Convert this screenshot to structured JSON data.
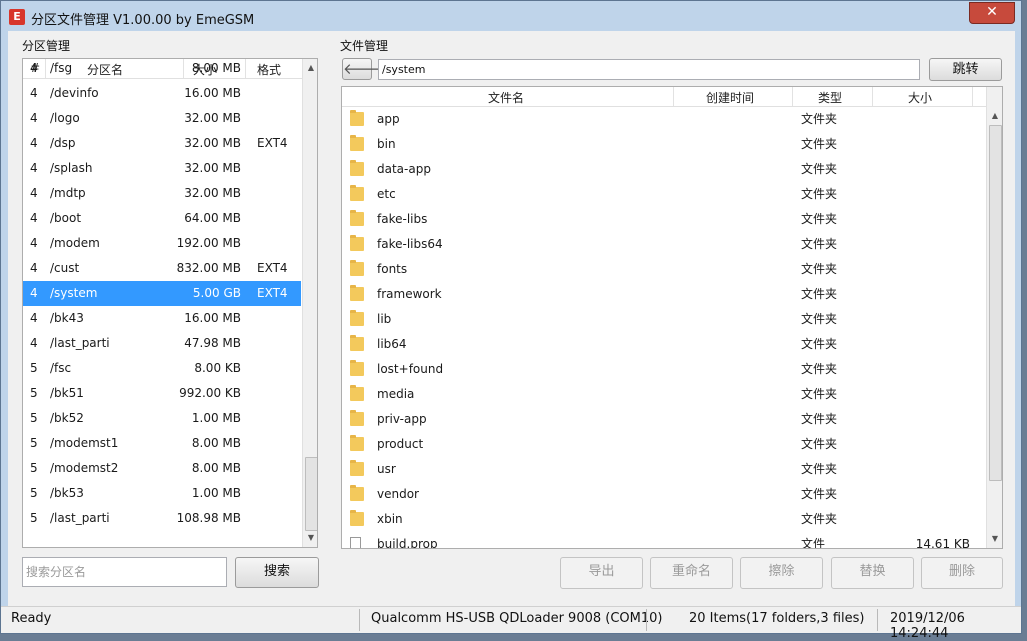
{
  "window": {
    "title": "分区文件管理 V1.00.00 by EmeGSM",
    "icon_glyph": "E",
    "close_glyph": "✕"
  },
  "partition_panel": {
    "group_label": "分区管理",
    "columns": {
      "num": "#",
      "name": "分区名",
      "size": "大小",
      "format": "格式"
    },
    "rows": [
      {
        "num": "4",
        "name": "/fsg",
        "size": "8.00 MB",
        "format": ""
      },
      {
        "num": "4",
        "name": "/devinfo",
        "size": "16.00 MB",
        "format": ""
      },
      {
        "num": "4",
        "name": "/logo",
        "size": "32.00 MB",
        "format": ""
      },
      {
        "num": "4",
        "name": "/dsp",
        "size": "32.00 MB",
        "format": "EXT4"
      },
      {
        "num": "4",
        "name": "/splash",
        "size": "32.00 MB",
        "format": ""
      },
      {
        "num": "4",
        "name": "/mdtp",
        "size": "32.00 MB",
        "format": ""
      },
      {
        "num": "4",
        "name": "/boot",
        "size": "64.00 MB",
        "format": ""
      },
      {
        "num": "4",
        "name": "/modem",
        "size": "192.00 MB",
        "format": ""
      },
      {
        "num": "4",
        "name": "/cust",
        "size": "832.00 MB",
        "format": "EXT4"
      },
      {
        "num": "4",
        "name": "/system",
        "size": "5.00 GB",
        "format": "EXT4",
        "selected": true
      },
      {
        "num": "4",
        "name": "/bk43",
        "size": "16.00 MB",
        "format": ""
      },
      {
        "num": "4",
        "name": "/last_parti",
        "size": "47.98 MB",
        "format": ""
      },
      {
        "num": "5",
        "name": "/fsc",
        "size": "8.00 KB",
        "format": ""
      },
      {
        "num": "5",
        "name": "/bk51",
        "size": "992.00 KB",
        "format": ""
      },
      {
        "num": "5",
        "name": "/bk52",
        "size": "1.00 MB",
        "format": ""
      },
      {
        "num": "5",
        "name": "/modemst1",
        "size": "8.00 MB",
        "format": ""
      },
      {
        "num": "5",
        "name": "/modemst2",
        "size": "8.00 MB",
        "format": ""
      },
      {
        "num": "5",
        "name": "/bk53",
        "size": "1.00 MB",
        "format": ""
      },
      {
        "num": "5",
        "name": "/last_parti",
        "size": "108.98 MB",
        "format": ""
      }
    ],
    "search_placeholder": "搜索分区名",
    "search_button": "搜索"
  },
  "file_panel": {
    "group_label": "文件管理",
    "back_glyph": "🡐",
    "path": "/system",
    "jump_button": "跳转",
    "columns": {
      "name": "文件名",
      "ctime": "创建时间",
      "type": "类型",
      "size": "大小"
    },
    "rows": [
      {
        "name": "app",
        "type": "文件夹",
        "size": "",
        "kind": "folder"
      },
      {
        "name": "bin",
        "type": "文件夹",
        "size": "",
        "kind": "folder"
      },
      {
        "name": "data-app",
        "type": "文件夹",
        "size": "",
        "kind": "folder"
      },
      {
        "name": "etc",
        "type": "文件夹",
        "size": "",
        "kind": "folder"
      },
      {
        "name": "fake-libs",
        "type": "文件夹",
        "size": "",
        "kind": "folder"
      },
      {
        "name": "fake-libs64",
        "type": "文件夹",
        "size": "",
        "kind": "folder"
      },
      {
        "name": "fonts",
        "type": "文件夹",
        "size": "",
        "kind": "folder"
      },
      {
        "name": "framework",
        "type": "文件夹",
        "size": "",
        "kind": "folder"
      },
      {
        "name": "lib",
        "type": "文件夹",
        "size": "",
        "kind": "folder"
      },
      {
        "name": "lib64",
        "type": "文件夹",
        "size": "",
        "kind": "folder"
      },
      {
        "name": "lost+found",
        "type": "文件夹",
        "size": "",
        "kind": "folder"
      },
      {
        "name": "media",
        "type": "文件夹",
        "size": "",
        "kind": "folder"
      },
      {
        "name": "priv-app",
        "type": "文件夹",
        "size": "",
        "kind": "folder"
      },
      {
        "name": "product",
        "type": "文件夹",
        "size": "",
        "kind": "folder"
      },
      {
        "name": "usr",
        "type": "文件夹",
        "size": "",
        "kind": "folder"
      },
      {
        "name": "vendor",
        "type": "文件夹",
        "size": "",
        "kind": "folder"
      },
      {
        "name": "xbin",
        "type": "文件夹",
        "size": "",
        "kind": "folder"
      },
      {
        "name": "build.prop",
        "type": "文件",
        "size": "14.61 KB",
        "kind": "file"
      }
    ],
    "buttons": {
      "export": "导出",
      "rename": "重命名",
      "erase": "擦除",
      "replace": "替换",
      "delete": "删除"
    }
  },
  "statusbar": {
    "ready": "Ready",
    "device": "Qualcomm HS-USB QDLoader 9008 (COM10)",
    "items": "20 Items(17 folders,3 files)",
    "datetime": "2019/12/06 14:24:44"
  }
}
